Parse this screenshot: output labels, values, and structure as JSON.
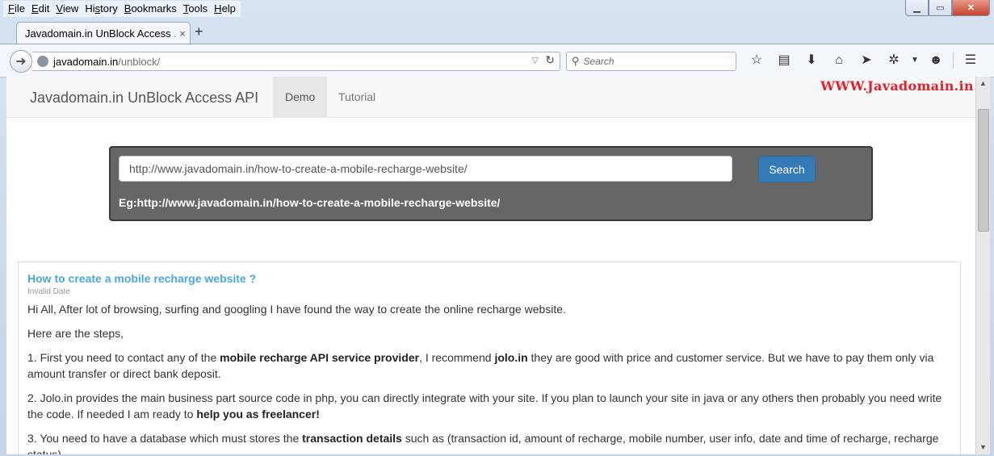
{
  "menu": [
    {
      "pre": "",
      "ul": "F",
      "post": "ile"
    },
    {
      "pre": "",
      "ul": "E",
      "post": "dit"
    },
    {
      "pre": "",
      "ul": "V",
      "post": "iew"
    },
    {
      "pre": "Hi",
      "ul": "s",
      "post": "tory"
    },
    {
      "pre": "",
      "ul": "B",
      "post": "ookmarks"
    },
    {
      "pre": "",
      "ul": "T",
      "post": "ools"
    },
    {
      "pre": "",
      "ul": "H",
      "post": "elp"
    }
  ],
  "tab": {
    "label": "Javadomain.in UnBlock Access ...",
    "close": "×",
    "new": "+"
  },
  "address": {
    "host": "javadomain.in",
    "path": "/unblock/"
  },
  "search": {
    "placeholder": "Search"
  },
  "site": {
    "brand": "Javadomain.in UnBlock Access API",
    "nav_demo": "Demo",
    "nav_tutorial": "Tutorial",
    "watermark": "WWW.Javadomain.in"
  },
  "panel": {
    "input_value": "http://www.javadomain.in/how-to-create-a-mobile-recharge-website/",
    "button": "Search",
    "example": "Eg:http://www.javadomain.in/how-to-create-a-mobile-recharge-website/"
  },
  "article": {
    "title": "How to create a mobile recharge website ?",
    "date": "Invalid Date",
    "p1": "Hi All, After lot of browsing, surfing and googling I have found the way to create the online recharge website.",
    "p2": "Here are the steps,",
    "p3a": "1. First you need to contact any of the ",
    "p3b": "mobile recharge API service provider",
    "p3c": ", I recommend ",
    "p3d": "jolo.in",
    "p3e": " they are good with price and customer service. But we have to pay them only via amount transfer or direct bank deposit.",
    "p4a": "2. Jolo.in provides the main business part source code in php, you can directly integrate with your site. If you plan to launch your site in java or any others then probably you need write the code. If needed I am ready to ",
    "p4b": "help you as freelancer!",
    "p5a": "3. You need to have a database which must stores the ",
    "p5b": "transaction details",
    "p5c": " such as (transaction id, amount of recharge, mobile number, user info, date and time of recharge, recharge status)"
  },
  "colors": {
    "accent": "#337ab7",
    "link": "#4aa8de",
    "watermark": "#e4212a"
  },
  "icons": [
    "back-arrow-icon",
    "globe-icon",
    "reload-icon",
    "search-icon",
    "bookmark-star-icon",
    "reading-list-icon",
    "download-icon",
    "home-icon",
    "send-icon",
    "extension-icon",
    "dropdown-icon",
    "chat-icon",
    "menu-icon"
  ]
}
